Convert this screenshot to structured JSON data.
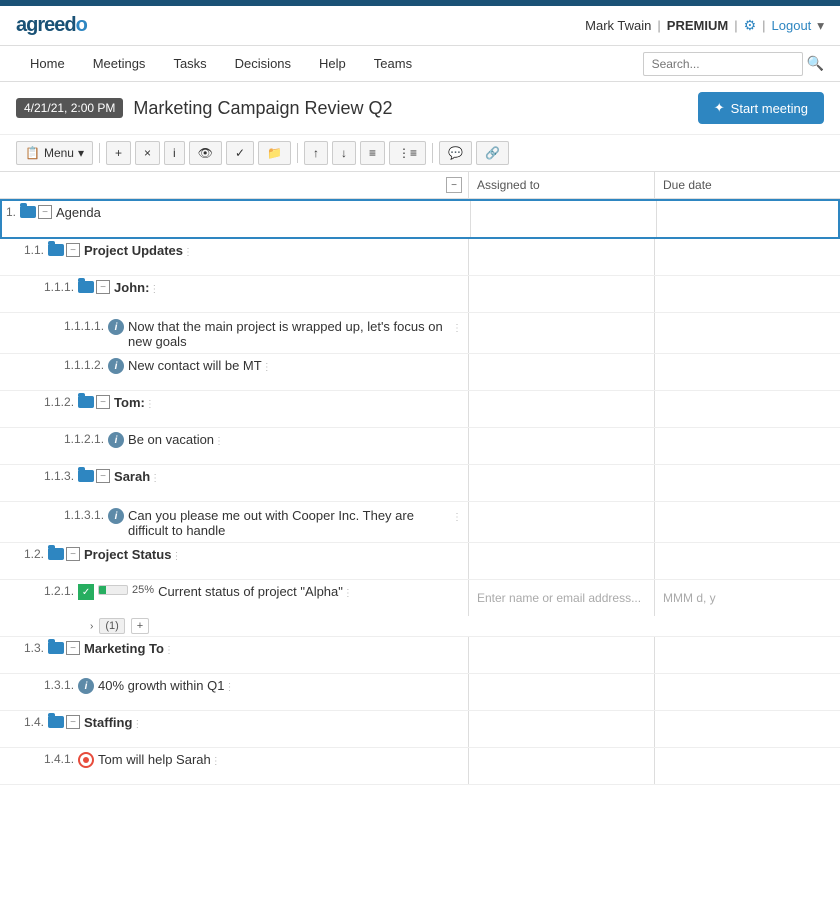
{
  "app": {
    "name": "agreedo",
    "topbar_color": "#1a5276"
  },
  "header": {
    "user": "Mark Twain",
    "premium_label": "PREMIUM",
    "logout_label": "Logout",
    "gear_icon": "⚙",
    "chevron_icon": "▾"
  },
  "nav": {
    "links": [
      "Home",
      "Meetings",
      "Tasks",
      "Decisions",
      "Help",
      "Teams"
    ],
    "search_placeholder": "Search..."
  },
  "meeting": {
    "date_badge": "4/21/21, 2:00 PM",
    "title": "Marketing Campaign Review Q2",
    "start_button": "Start meeting"
  },
  "toolbar": {
    "menu_label": "Menu",
    "menu_chevron": "▾",
    "buttons": [
      "+",
      "×",
      "i",
      "👁",
      "✓",
      "📁",
      "↑",
      "↓",
      "≡",
      "≡≡",
      "💬",
      "🔗"
    ]
  },
  "columns": {
    "collapse_icon": "−",
    "assigned_label": "Assigned to",
    "due_label": "Due date"
  },
  "rows": [
    {
      "num": "1.",
      "indent": 0,
      "type": "section",
      "label": "Agenda",
      "editing": true,
      "assigned": "",
      "due": ""
    },
    {
      "num": "1.1.",
      "indent": 1,
      "type": "section",
      "label": "Project Updates",
      "assigned": "",
      "due": ""
    },
    {
      "num": "1.1.1.",
      "indent": 2,
      "type": "section",
      "label": "John:",
      "assigned": "",
      "due": ""
    },
    {
      "num": "1.1.1.1.",
      "indent": 3,
      "type": "info",
      "label": "Now that the main project is wrapped up, let's focus on new goals",
      "assigned": "",
      "due": ""
    },
    {
      "num": "1.1.1.2.",
      "indent": 3,
      "type": "info",
      "label": "New contact will be MT",
      "assigned": "",
      "due": ""
    },
    {
      "num": "1.1.2.",
      "indent": 2,
      "type": "section",
      "label": "Tom:",
      "assigned": "",
      "due": ""
    },
    {
      "num": "1.1.2.1.",
      "indent": 3,
      "type": "info",
      "label": "Be on vacation",
      "assigned": "",
      "due": ""
    },
    {
      "num": "1.1.3.",
      "indent": 2,
      "type": "section",
      "label": "Sarah",
      "assigned": "",
      "due": ""
    },
    {
      "num": "1.1.3.1.",
      "indent": 3,
      "type": "info",
      "label": "Can you please me out with Cooper Inc. They are difficult to handle",
      "assigned": "",
      "due": ""
    },
    {
      "num": "1.2.",
      "indent": 1,
      "type": "section",
      "label": "Project Status",
      "assigned": "",
      "due": ""
    },
    {
      "num": "1.2.1.",
      "indent": 2,
      "type": "task",
      "label": "Current status of project \"Alpha\"",
      "progress": 25,
      "assigned": "Enter name or email address...",
      "due": "MMM d, y",
      "has_sub": true,
      "sub_count": 1
    },
    {
      "num": "1.3.",
      "indent": 1,
      "type": "section",
      "label": "Marketing To",
      "assigned": "",
      "due": ""
    },
    {
      "num": "1.3.1.",
      "indent": 2,
      "type": "info",
      "label": "40% growth within Q1",
      "assigned": "",
      "due": ""
    },
    {
      "num": "1.4.",
      "indent": 1,
      "type": "section",
      "label": "Staffing",
      "assigned": "",
      "due": ""
    },
    {
      "num": "1.4.1.",
      "indent": 2,
      "type": "action",
      "label": "Tom will help Sarah",
      "assigned": "",
      "due": ""
    }
  ]
}
